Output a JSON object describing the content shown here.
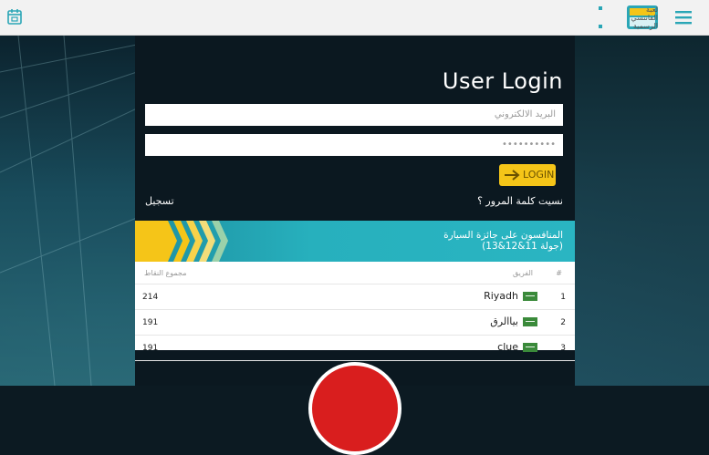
{
  "header": {
    "logo_text_line1": "دوري جميل",
    "logo_text_line2": "لعبة",
    "logo_text_line3": "الفانتسي",
    "logo_text_line4": "الرسمية"
  },
  "login": {
    "title": "User Login",
    "email_placeholder": "البريد الالكتروني",
    "password_value": "••••••••••",
    "login_label": "LOGIN",
    "register_link": "تسجيل",
    "forgot_link": "نسيت كلمة المرور ؟"
  },
  "banner": {
    "line1": "المنافسون على جائزة السيارة",
    "line2": "(جولة 11&12&13)"
  },
  "table": {
    "headers": {
      "rank": "#",
      "team": "الفريق",
      "points": "مجموع النقاط"
    },
    "rows": [
      {
        "rank": "1",
        "team": "Riyadh",
        "points": "214"
      },
      {
        "rank": "2",
        "team": "بياالرق",
        "points": "191"
      },
      {
        "rank": "3",
        "team": "clue",
        "points": "191"
      }
    ]
  },
  "colors": {
    "accent_yellow": "#f5c518",
    "banner_teal": "#27b0bd",
    "flag_green": "#3a8a3a"
  }
}
